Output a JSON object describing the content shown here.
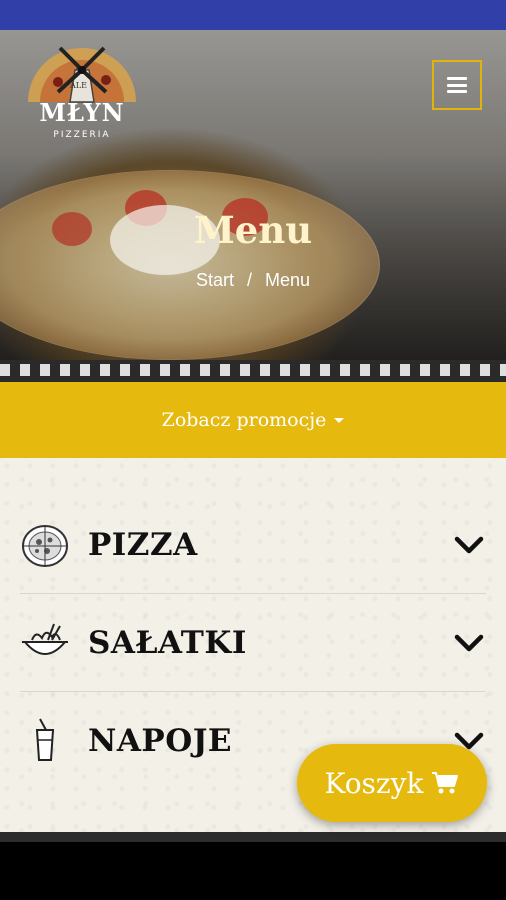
{
  "brand": {
    "logo_tag": "ALE",
    "logo_name": "MŁYN",
    "logo_sub": "PIZZERIA"
  },
  "header": {
    "menu_icon": "hamburger-icon",
    "title": "Menu",
    "breadcrumb": {
      "home": "Start",
      "separator": "/",
      "current": "Menu"
    }
  },
  "promo": {
    "label": "Zobacz promocje",
    "icon": "caret-down-icon"
  },
  "categories": [
    {
      "label": "PIZZA",
      "icon": "pizza-icon"
    },
    {
      "label": "SAŁATKI",
      "icon": "salad-bowl-icon"
    },
    {
      "label": "NAPOJE",
      "icon": "drink-cup-icon"
    }
  ],
  "cart": {
    "label": "Koszyk",
    "icon": "shopping-cart-icon"
  },
  "colors": {
    "status_bar": "#3040a8",
    "accent": "#e6b90f",
    "content_bg": "#f3f0e8",
    "hero_title": "#fff3cc"
  }
}
